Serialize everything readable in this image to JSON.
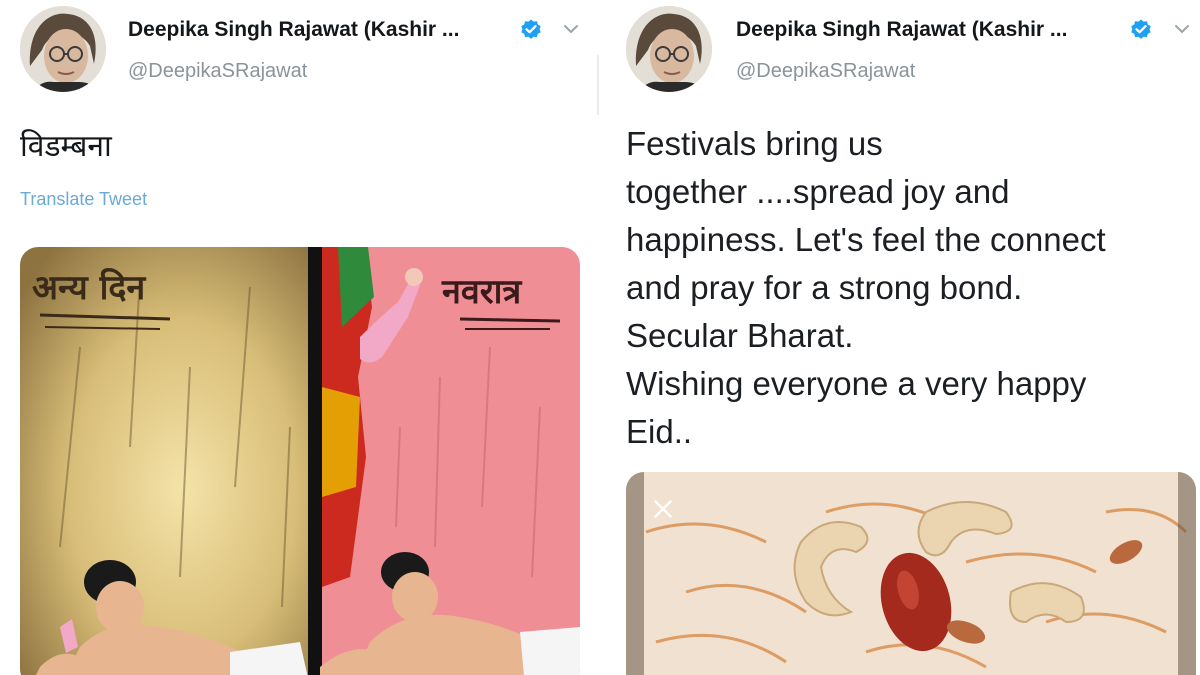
{
  "left_tweet": {
    "display_name": "Deepika Singh Rajawat (Kashir ...",
    "handle": "@DeepikaSRajawat",
    "text": "विडम्बना",
    "translate_label": "Translate Tweet",
    "image": {
      "left_caption": "अन्य दिन",
      "right_caption": "नवरात्र"
    }
  },
  "right_tweet": {
    "display_name": "Deepika Singh Rajawat (Kashir ...",
    "handle": "@DeepikaSRajawat",
    "text_lines": [
      "Festivals bring us",
      "together ....spread joy and",
      "happiness.  Let's feel the connect",
      "and pray for a strong bond.",
      "Secular Bharat.",
      "Wishing everyone a very happy",
      "Eid.."
    ]
  },
  "icons": {
    "verified": "verified-badge-icon",
    "more": "chevron-down-icon",
    "media_close": "close-icon"
  },
  "colors": {
    "verified_blue": "#1da1f2",
    "link_blue": "#6aa9d8",
    "handle_grey": "#8a9399"
  }
}
